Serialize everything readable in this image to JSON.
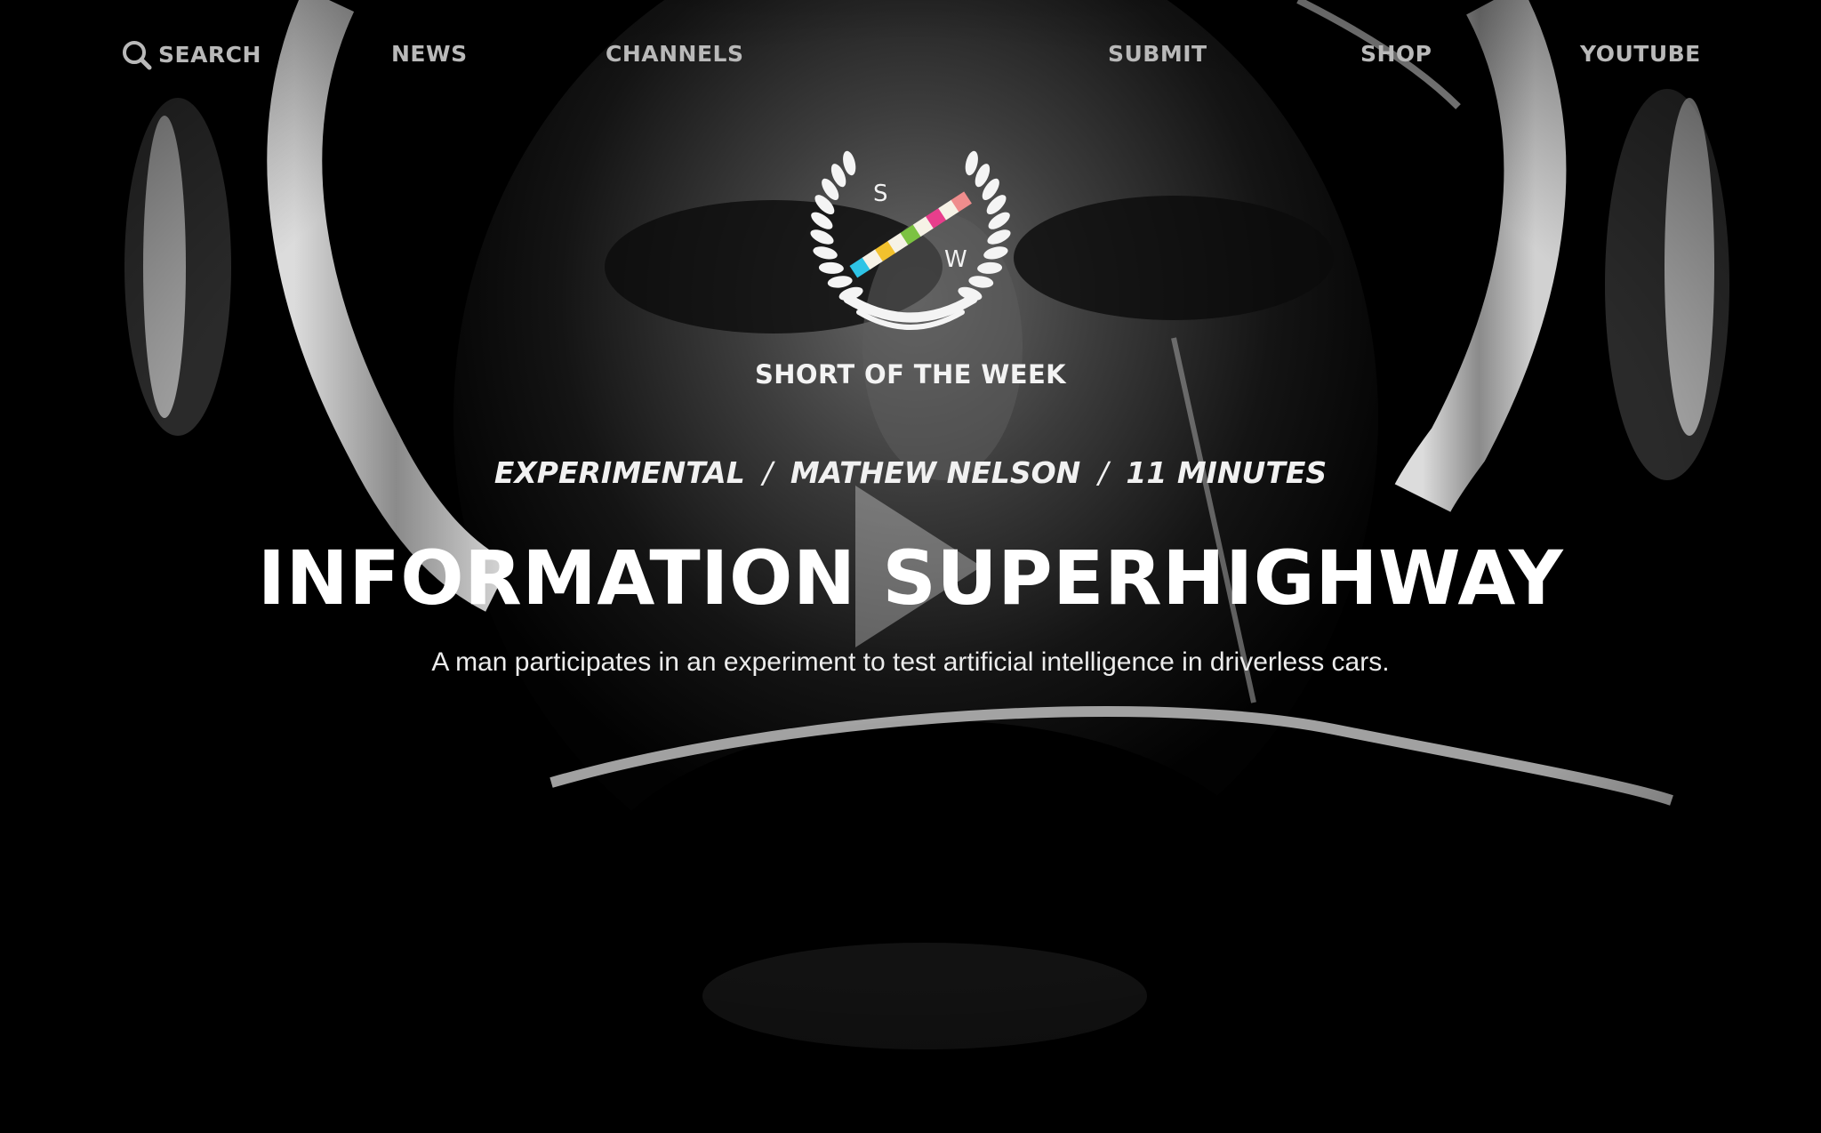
{
  "nav": {
    "search_label": "SEARCH",
    "news_label": "NEWS",
    "channels_label": "CHANNELS",
    "submit_label": "SUBMIT",
    "shop_label": "SHOP",
    "youtube_label": "YOUTUBE",
    "text_color": "#b9b9b9"
  },
  "brand": {
    "logo_letter_left": "S",
    "logo_letter_right": "W",
    "name": "SHORT OF THE WEEK",
    "stripe_colors": [
      "#2ec4e6",
      "#f6f2e6",
      "#f2c12e",
      "#f6f2e6",
      "#7cc242",
      "#f6f2e6",
      "#e83e8c",
      "#f6f2e6",
      "#ef8d8d"
    ]
  },
  "film": {
    "genre": "EXPERIMENTAL",
    "director": "MATHEW NELSON",
    "duration": "11 MINUTES",
    "meta_separator": "/",
    "title": "INFORMATION SUPERHIGHWAY",
    "description": "A man participates in an experiment to test artificial intelligence in driverless cars."
  },
  "icons": {
    "search": "search-icon",
    "play": "play-icon"
  }
}
